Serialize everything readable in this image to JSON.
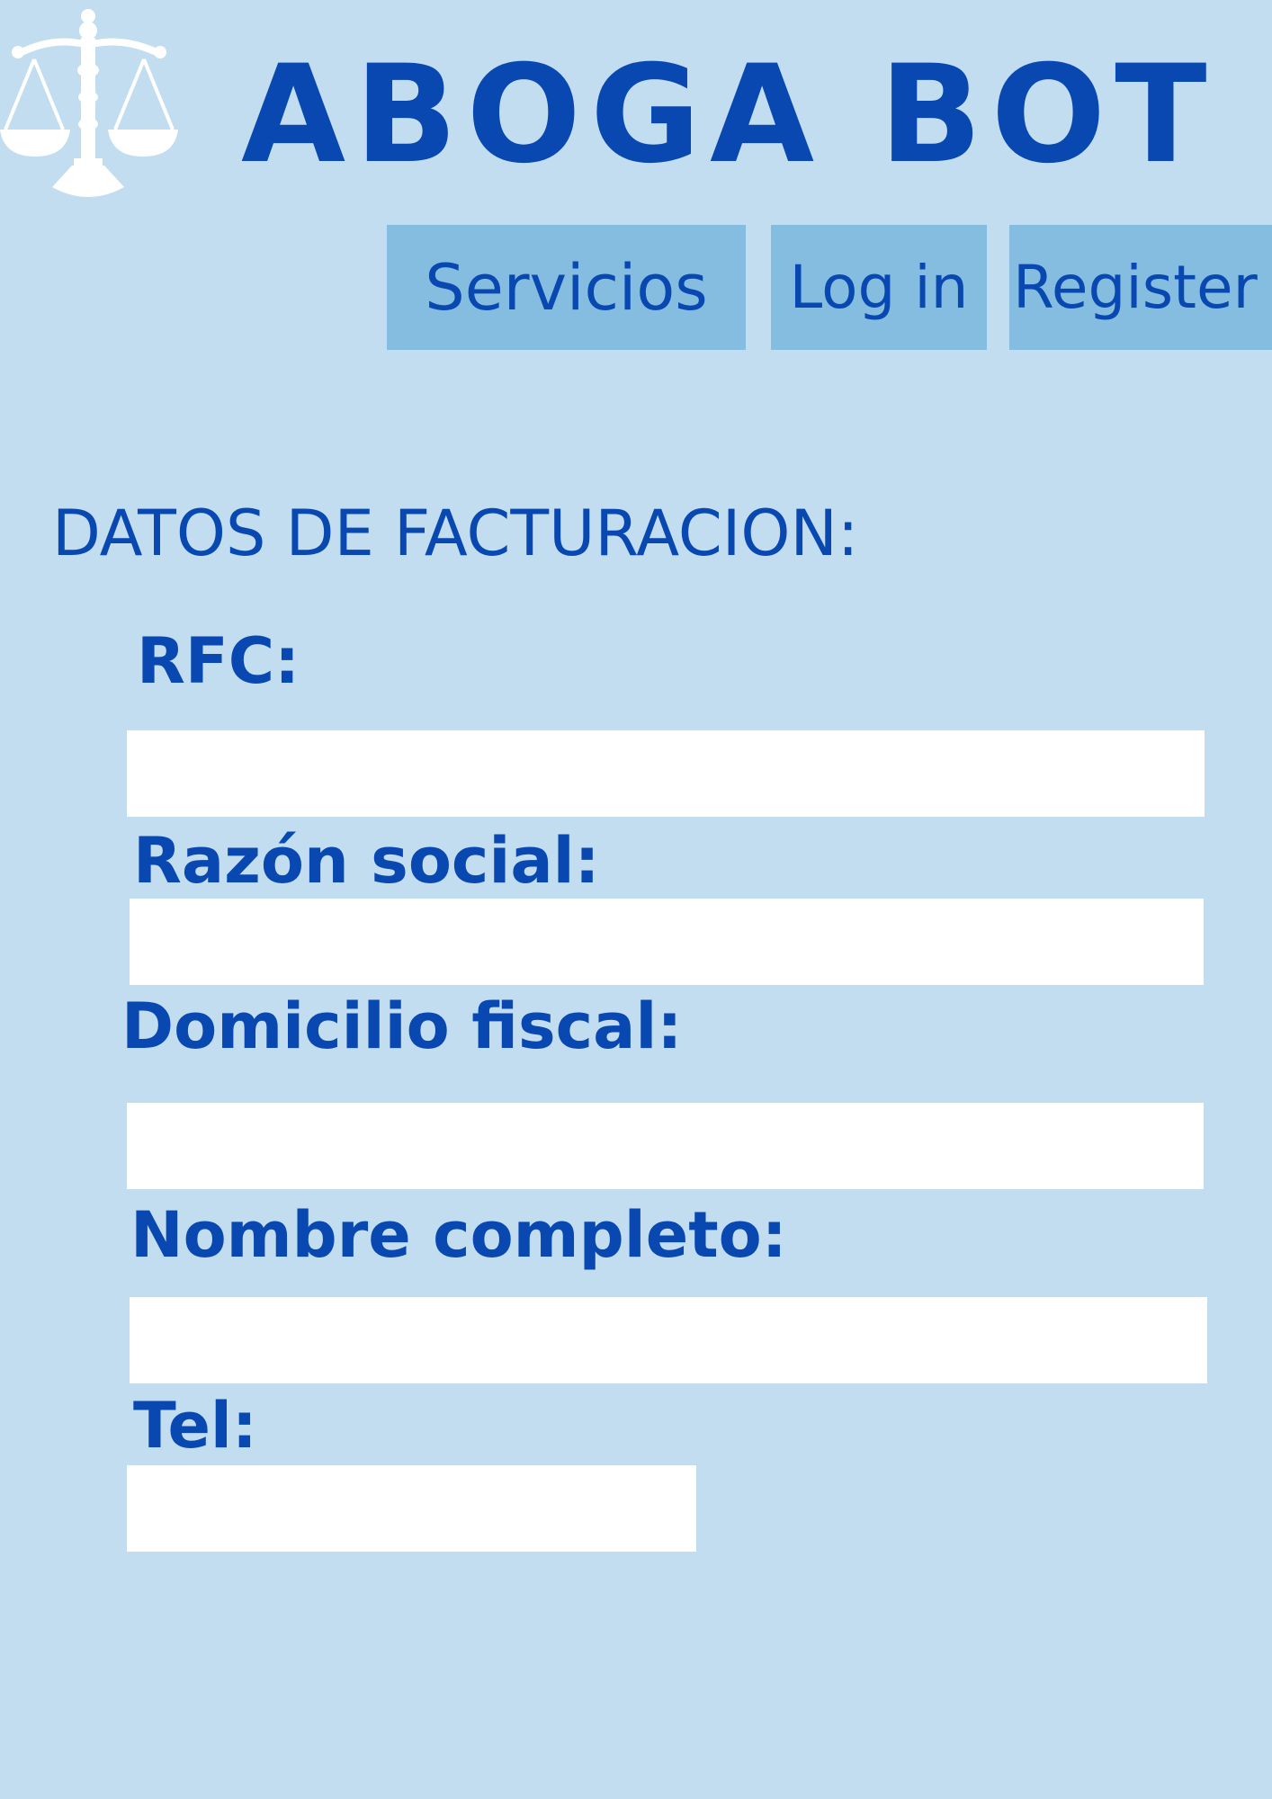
{
  "header": {
    "logo_icon": "scales-of-justice-icon",
    "brand": "ABOGA BOT"
  },
  "nav": {
    "servicios": "Servicios",
    "login": "Log in",
    "register": "Register"
  },
  "form": {
    "title": "DATOS DE FACTURACION:",
    "fields": [
      {
        "label": "RFC:",
        "value": "",
        "placeholder": ""
      },
      {
        "label": "Razón social:",
        "value": "",
        "placeholder": ""
      },
      {
        "label": "Domicilio fiscal:",
        "value": "",
        "placeholder": ""
      },
      {
        "label": "Nombre completo:",
        "value": "",
        "placeholder": ""
      },
      {
        "label": "Tel:",
        "value": "",
        "placeholder": ""
      }
    ]
  },
  "colors": {
    "background": "#c1ddef",
    "accent": "#0848b0",
    "nav_button": "#85bde0",
    "input": "#ffffff"
  }
}
